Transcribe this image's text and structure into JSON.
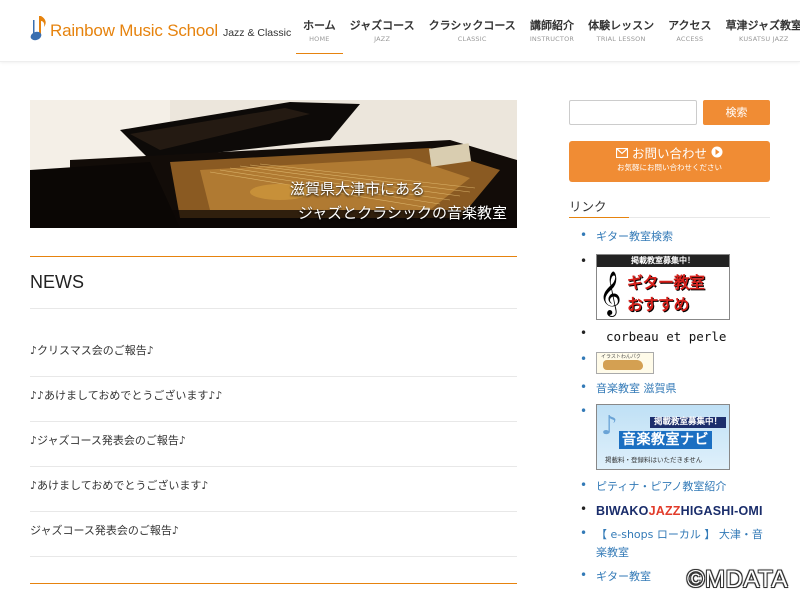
{
  "brand": {
    "title": "Rainbow Music School",
    "subtitle": "Jazz & Classic"
  },
  "nav": [
    {
      "jp": "ホーム",
      "en": "HOME"
    },
    {
      "jp": "ジャズコース",
      "en": "JAZZ"
    },
    {
      "jp": "クラシックコース",
      "en": "CLASSIC"
    },
    {
      "jp": "講師紹介",
      "en": "INSTRUCTOR"
    },
    {
      "jp": "体験レッスン",
      "en": "TRIAL LESSON"
    },
    {
      "jp": "アクセス",
      "en": "ACCESS"
    },
    {
      "jp": "草津ジャズ教室",
      "en": "KUSATSU JAZZ"
    }
  ],
  "hero": {
    "line1": "滋賀県大津市にある",
    "line2": "ジャズとクラシックの音楽教室"
  },
  "news": {
    "title": "NEWS",
    "items": [
      "♪クリスマス会のご報告♪",
      "♪♪あけましておめでとうございます♪♪",
      "♪ジャズコース発表会のご報告♪",
      "♪あけましておめでとうございます♪",
      "ジャズコース発表会のご報告♪"
    ]
  },
  "sidebar": {
    "search_placeholder": "",
    "search_button": "検索",
    "contact_main": "お問い合わせ",
    "contact_sub": "お気軽にお問い合わせください",
    "links_title": "リンク",
    "links": {
      "guitar_search": "ギター教室検索",
      "guitar_banner_head": "掲載教室募集中！",
      "guitar_banner_l1": "ギター教室",
      "guitar_banner_l2": "おすすめ",
      "corbeau": "corbeau et perle",
      "dog_banner_text": "イラストわんパク",
      "music_shiga": "音楽教室 滋賀県",
      "navi_head": "掲載教室募集中！",
      "navi_title": "音楽教室ナビ",
      "navi_foot": "掲載料・登録料はいただきません",
      "piano": "ピティナ・ピアノ教室紹介",
      "biwako_a": "BIWAKO",
      "biwako_b": "JAZZ",
      "biwako_c": "HIGASHI-OMI",
      "eshops": "【 e-shops ローカル 】 大津・音楽教室",
      "guitar_more": "ギター教室"
    }
  },
  "watermark": "©MDATA",
  "colors": {
    "accent": "#f08c34",
    "link": "#337ab7",
    "brand_orange": "#e6830e"
  }
}
